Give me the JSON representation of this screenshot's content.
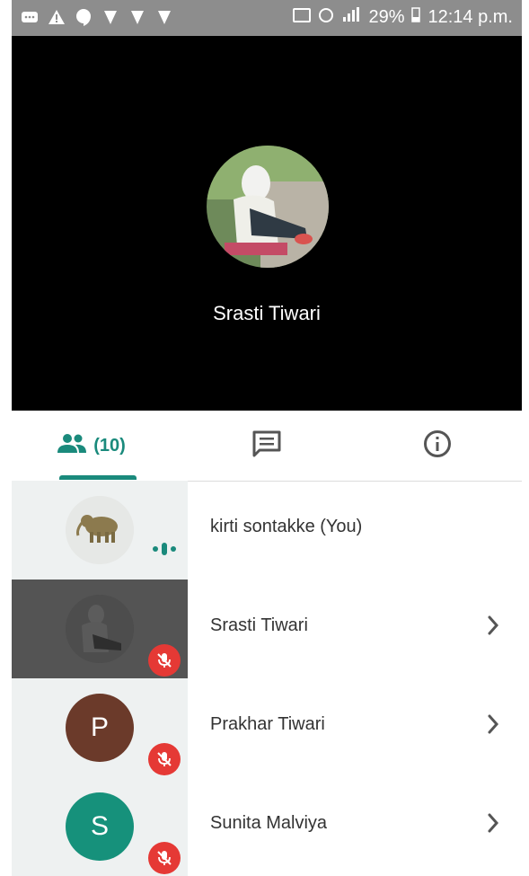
{
  "status_bar": {
    "battery": "29%",
    "time": "12:14 p.m."
  },
  "stage": {
    "speaker_name": "Srasti Tiwari"
  },
  "tabs": {
    "people_count": "(10)"
  },
  "participants": [
    {
      "name": "kirti sontakke (You)"
    },
    {
      "name": "Srasti Tiwari"
    },
    {
      "name": "Prakhar Tiwari",
      "initial": "P",
      "color": "#6b3a2a"
    },
    {
      "name": "Sunita Malviya",
      "initial": "S",
      "color": "#16917b"
    }
  ],
  "colors": {
    "accent": "#1a8a7c",
    "mute": "#e53935"
  }
}
